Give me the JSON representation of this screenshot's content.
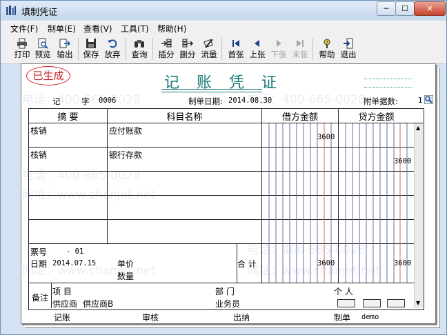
{
  "window": {
    "title": "填制凭证",
    "min_label": "─",
    "max_label": "☐",
    "close_label": "✕"
  },
  "menu": [
    "文件(F)",
    "制单(E)",
    "查看(V)",
    "工具(T)",
    "帮助(H)"
  ],
  "toolbar": [
    {
      "label": "打印",
      "icon": "printer-icon",
      "enabled": true
    },
    {
      "label": "预览",
      "icon": "preview-icon",
      "enabled": true
    },
    {
      "label": "输出",
      "icon": "export-icon",
      "enabled": true
    },
    {
      "label": "保存",
      "icon": "save-icon",
      "enabled": true
    },
    {
      "label": "放弃",
      "icon": "undo-icon",
      "enabled": true
    },
    {
      "label": "查询",
      "icon": "binoculars-icon",
      "enabled": true
    },
    {
      "label": "插分",
      "icon": "insert-row-icon",
      "enabled": true
    },
    {
      "label": "删分",
      "icon": "delete-row-icon",
      "enabled": true
    },
    {
      "label": "流量",
      "icon": "flow-icon",
      "enabled": true
    },
    {
      "label": "首张",
      "icon": "first-icon",
      "enabled": true
    },
    {
      "label": "上张",
      "icon": "previous-icon",
      "enabled": true
    },
    {
      "label": "下张",
      "icon": "next-icon",
      "enabled": false
    },
    {
      "label": "末张",
      "icon": "last-icon",
      "enabled": false
    },
    {
      "label": "帮助",
      "icon": "help-icon",
      "enabled": true
    },
    {
      "label": "退出",
      "icon": "exit-icon",
      "enabled": true
    }
  ],
  "voucher": {
    "status_stamp": "已生成",
    "title": "记 账 凭 证",
    "type_label": "记",
    "number_label": "字",
    "number": "0006",
    "date_label": "制单日期:",
    "date": "2014.08.30",
    "attachments_label": "附单据数:",
    "attachments": "1"
  },
  "columns": {
    "summary": "摘 要",
    "account": "科目名称",
    "debit": "借方金额",
    "credit": "贷方金额"
  },
  "rows": [
    {
      "summary": "核销",
      "account": "应付账款",
      "debit": "3600",
      "credit": ""
    },
    {
      "summary": "核销",
      "account": "银行存款",
      "debit": "",
      "credit": "3600"
    }
  ],
  "footer": {
    "ticket_label": "票号",
    "ticket": "- 01",
    "date_label": "日期",
    "date": "2014.07.15",
    "unit_price_label": "单价",
    "quantity_label": "数量",
    "total_label": "合 计",
    "total_debit": "3600",
    "total_credit": "3600",
    "remarks_label": "备注",
    "project_label": "项 目",
    "department_label": "部 门",
    "person_label": "个 人",
    "supplier_label": "供应商",
    "supplier": "供应商B",
    "salesperson_label": "业务员"
  },
  "signatures": {
    "bookkeeper": "记账",
    "auditor": "审核",
    "cashier": "出纳",
    "preparer": "制单",
    "preparer_name": "demo"
  },
  "watermarks": [
    "电话：400-665-0028",
    "网址：www.chanjet.net"
  ],
  "colors": {
    "accent": "#1a7a7a",
    "stamp": "#c81e1e",
    "credit_line": "#d06a6a",
    "grid_line": "#6a6aa8"
  }
}
